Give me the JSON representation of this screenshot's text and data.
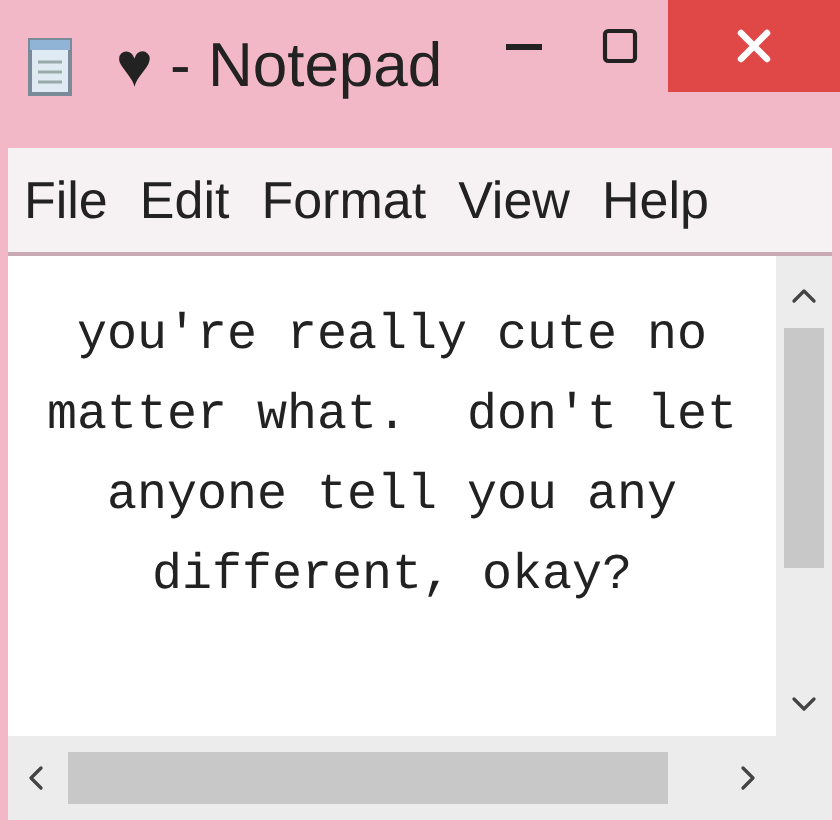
{
  "window": {
    "title": "♥ - Notepad"
  },
  "menu": [
    {
      "label": "File"
    },
    {
      "label": "Edit"
    },
    {
      "label": "Format"
    },
    {
      "label": "View"
    },
    {
      "label": "Help"
    }
  ],
  "document": {
    "lines": [
      "you're really cute no",
      "matter what.  don't let",
      "anyone tell you any",
      "different, okay?"
    ]
  }
}
